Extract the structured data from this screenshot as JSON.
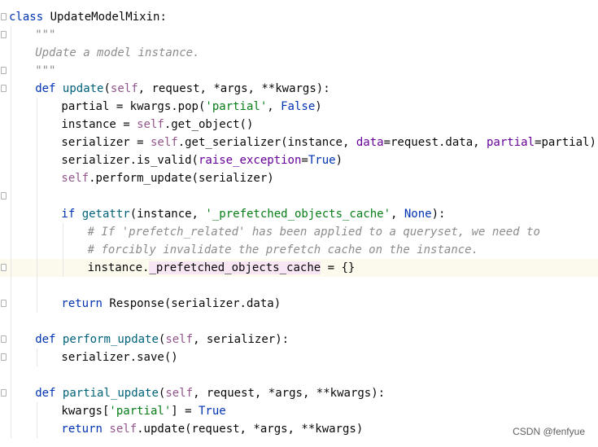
{
  "editor": {
    "lines": [
      {
        "indent": 0,
        "tokens": [
          {
            "t": "class ",
            "c": "kw"
          },
          {
            "t": "UpdateModelMixin:",
            "c": ""
          }
        ]
      },
      {
        "indent": 1,
        "tokens": [
          {
            "t": "\"\"\"",
            "c": "doc"
          }
        ]
      },
      {
        "indent": 1,
        "tokens": [
          {
            "t": "Update a model instance.",
            "c": "doc"
          }
        ]
      },
      {
        "indent": 1,
        "tokens": [
          {
            "t": "\"\"\"",
            "c": "doc"
          }
        ]
      },
      {
        "indent": 1,
        "tokens": [
          {
            "t": "def ",
            "c": "kw"
          },
          {
            "t": "update",
            "c": "fn"
          },
          {
            "t": "(",
            "c": ""
          },
          {
            "t": "self",
            "c": "self"
          },
          {
            "t": ", request, *args, **kwargs):",
            "c": ""
          }
        ]
      },
      {
        "indent": 2,
        "tokens": [
          {
            "t": "partial = kwargs.pop(",
            "c": ""
          },
          {
            "t": "'partial'",
            "c": "str"
          },
          {
            "t": ", ",
            "c": ""
          },
          {
            "t": "False",
            "c": "kw"
          },
          {
            "t": ")",
            "c": ""
          }
        ]
      },
      {
        "indent": 2,
        "tokens": [
          {
            "t": "instance = ",
            "c": ""
          },
          {
            "t": "self",
            "c": "self"
          },
          {
            "t": ".get_object()",
            "c": ""
          }
        ]
      },
      {
        "indent": 2,
        "tokens": [
          {
            "t": "serializer = ",
            "c": ""
          },
          {
            "t": "self",
            "c": "self"
          },
          {
            "t": ".get_serializer(instance, ",
            "c": ""
          },
          {
            "t": "data",
            "c": "param"
          },
          {
            "t": "=request.data, ",
            "c": ""
          },
          {
            "t": "partial",
            "c": "param"
          },
          {
            "t": "=partial)",
            "c": ""
          }
        ]
      },
      {
        "indent": 2,
        "tokens": [
          {
            "t": "serializer.is_valid(",
            "c": ""
          },
          {
            "t": "raise_exception",
            "c": "param"
          },
          {
            "t": "=",
            "c": ""
          },
          {
            "t": "True",
            "c": "kw"
          },
          {
            "t": ")",
            "c": ""
          }
        ]
      },
      {
        "indent": 2,
        "tokens": [
          {
            "t": "self",
            "c": "self"
          },
          {
            "t": ".perform_update(serializer)",
            "c": ""
          }
        ]
      },
      {
        "indent": 0,
        "tokens": []
      },
      {
        "indent": 2,
        "tokens": [
          {
            "t": "if ",
            "c": "kw"
          },
          {
            "t": "getattr",
            "c": "fn"
          },
          {
            "t": "(instance, ",
            "c": ""
          },
          {
            "t": "'_prefetched_objects_cache'",
            "c": "str"
          },
          {
            "t": ", ",
            "c": ""
          },
          {
            "t": "None",
            "c": "kw"
          },
          {
            "t": "):",
            "c": ""
          }
        ]
      },
      {
        "indent": 3,
        "tokens": [
          {
            "t": "# If 'prefetch_related' has been applied to a queryset, we need to",
            "c": "comment"
          }
        ]
      },
      {
        "indent": 3,
        "tokens": [
          {
            "t": "# forcibly invalidate the prefetch cache on the instance.",
            "c": "comment"
          }
        ]
      },
      {
        "indent": 3,
        "current": true,
        "tokens": [
          {
            "t": "instance.",
            "c": ""
          },
          {
            "t": "_prefetched_objects_cache",
            "c": "dunder"
          },
          {
            "t": " = {}",
            "c": ""
          }
        ]
      },
      {
        "indent": 0,
        "tokens": []
      },
      {
        "indent": 2,
        "tokens": [
          {
            "t": "return ",
            "c": "kw"
          },
          {
            "t": "Response(serializer.data)",
            "c": ""
          }
        ]
      },
      {
        "indent": 0,
        "tokens": []
      },
      {
        "indent": 1,
        "tokens": [
          {
            "t": "def ",
            "c": "kw"
          },
          {
            "t": "perform_update",
            "c": "fn"
          },
          {
            "t": "(",
            "c": ""
          },
          {
            "t": "self",
            "c": "self"
          },
          {
            "t": ", serializer):",
            "c": ""
          }
        ]
      },
      {
        "indent": 2,
        "tokens": [
          {
            "t": "serializer.save()",
            "c": ""
          }
        ]
      },
      {
        "indent": 0,
        "tokens": []
      },
      {
        "indent": 1,
        "tokens": [
          {
            "t": "def ",
            "c": "kw"
          },
          {
            "t": "partial_update",
            "c": "fn"
          },
          {
            "t": "(",
            "c": ""
          },
          {
            "t": "self",
            "c": "self"
          },
          {
            "t": ", request, *args, **kwargs):",
            "c": ""
          }
        ]
      },
      {
        "indent": 2,
        "tokens": [
          {
            "t": "kwargs[",
            "c": ""
          },
          {
            "t": "'partial'",
            "c": "str"
          },
          {
            "t": "] = ",
            "c": ""
          },
          {
            "t": "True",
            "c": "kw"
          }
        ]
      },
      {
        "indent": 2,
        "tokens": [
          {
            "t": "return ",
            "c": "kw"
          },
          {
            "t": "self",
            "c": "self"
          },
          {
            "t": ".update(request, *args, **kwargs)",
            "c": ""
          }
        ]
      }
    ],
    "fold_markers": [
      0,
      1,
      3,
      4,
      10,
      14,
      16,
      18,
      19,
      21
    ]
  },
  "watermark": "CSDN @fenfyue"
}
